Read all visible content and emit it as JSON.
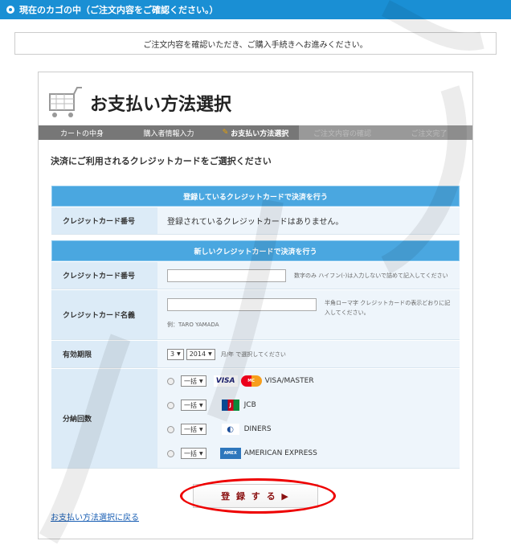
{
  "topbar": {
    "title": "現在のカゴの中（ご注文内容をご確認ください。）"
  },
  "notice": {
    "text": "ご注文内容を確認いただき、ご購入手続きへお進みください。"
  },
  "page": {
    "title": "お支払い方法選択"
  },
  "steps": [
    {
      "label": "カートの中身"
    },
    {
      "label": "購入者情報入力"
    },
    {
      "label": "お支払い方法選択"
    },
    {
      "label": "ご注文内容の確認"
    },
    {
      "label": "ご注文完了"
    }
  ],
  "subtitle": "決済にご利用されるクレジットカードをご選択ください",
  "registered": {
    "head": "登録しているクレジットカードで決済を行う",
    "card_label": "クレジットカード番号",
    "card_value": "登録されているクレジットカードはありません。"
  },
  "newcard": {
    "head": "新しいクレジットカードで決済を行う",
    "number_label": "クレジットカード番号",
    "number_hint": "数字のみ ハイフン(-)は入力しないで詰めて記入してください",
    "name_label": "クレジットカード名義",
    "name_hint": "半角ローマ字 クレジットカードの表示どおりに記入してください。",
    "name_example": "例：TARO YAMADA",
    "expiry_label": "有効期限",
    "expiry_month": "3",
    "expiry_year": "2014",
    "expiry_hint": "月/年 で選択してください",
    "installment_label": "分納回数",
    "installment_options": [
      {
        "select": "一括",
        "brand": "VISA/MASTER"
      },
      {
        "select": "一括",
        "brand": "JCB"
      },
      {
        "select": "一括",
        "brand": "DINERS"
      },
      {
        "select": "一括",
        "brand": "AMERICAN EXPRESS"
      }
    ]
  },
  "submit": {
    "label": "登 録 す る ▶"
  },
  "back": {
    "label": "お支払い方法選択に戻る"
  },
  "colors": {
    "accent": "#1a8fd4",
    "section": "#4aa7e0",
    "highlight": "#e00000"
  }
}
